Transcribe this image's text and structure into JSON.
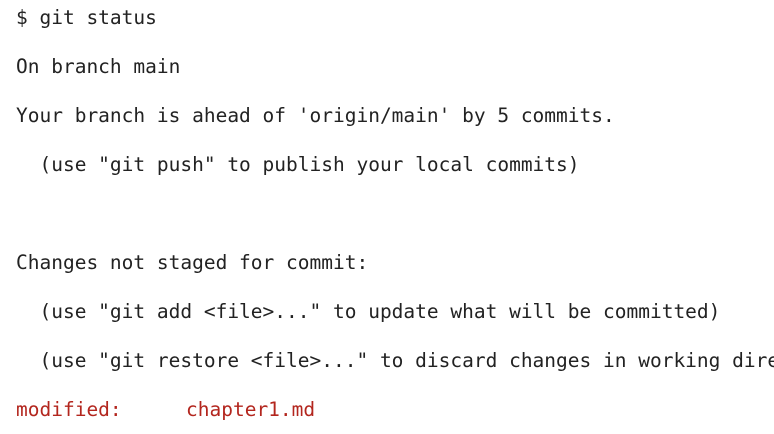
{
  "terminal": {
    "prompt": "$ git status",
    "branch_line": "On branch main",
    "ahead_line": "Your branch is ahead of 'origin/main' by 5 commits.",
    "push_hint": "  (use \"git push\" to publish your local commits)",
    "unstaged_header": "Changes not staged for commit:",
    "add_hint": "  (use \"git add <file>...\" to update what will be committed)",
    "restore_hint": "  (use \"git restore <file>...\" to discard changes in working directory)",
    "modified_label": "modified:",
    "modified_file": "chapter1.md",
    "modified_color": "#b3261e"
  }
}
